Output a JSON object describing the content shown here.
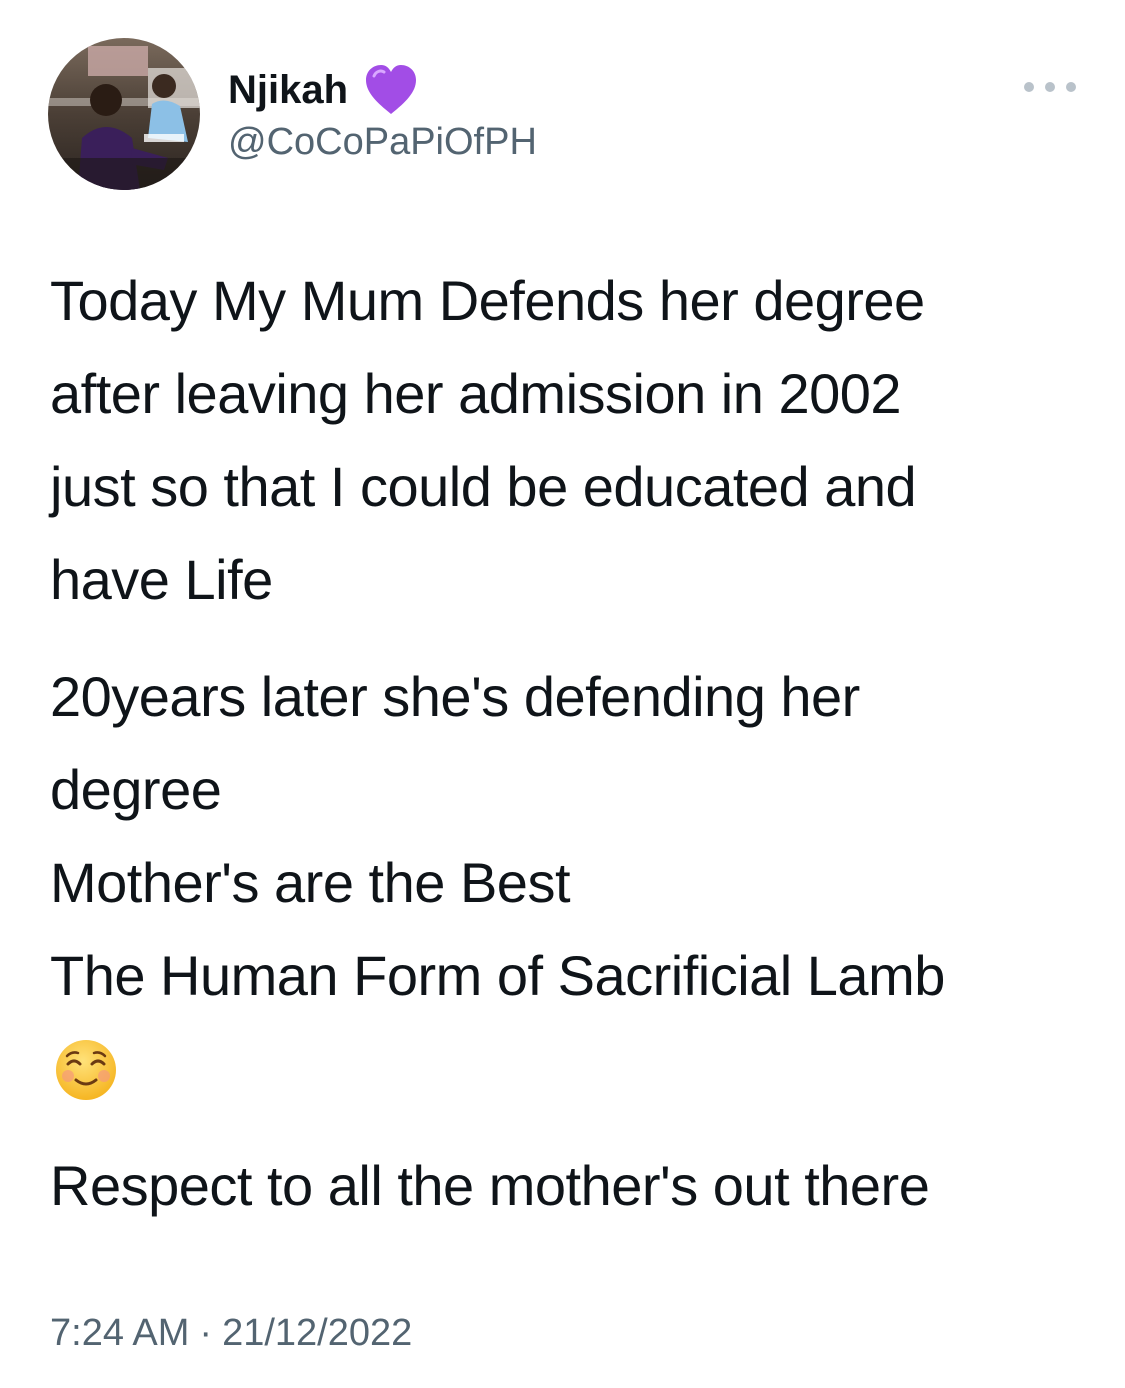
{
  "author": {
    "display_name": "Njikah",
    "handle": "@CoCoPaPiOfPH",
    "badge_icon": "purple-heart-icon",
    "badge_color": "#a24de6"
  },
  "tweet": {
    "paragraphs": [
      {
        "lines": [
          "Today My Mum Defends her degree",
          "after leaving her admission in 2002",
          "just so that I could be educated and",
          "have Life"
        ]
      },
      {
        "lines": [
          "20years later she's defending her",
          "degree",
          "Mother's are the Best",
          "The Human Form of Sacrificial Lamb"
        ],
        "emoji": "smiling-face-icon"
      },
      {
        "lines": [
          "Respect to all the mother's out there"
        ]
      }
    ]
  },
  "meta": {
    "time": "7:24 AM",
    "separator": "·",
    "date": "21/12/2022"
  },
  "menu": {
    "icon": "more-options-icon"
  },
  "colors": {
    "text": "#0f1419",
    "secondary_text": "#536471",
    "background": "#ffffff",
    "dots": "#b9c2ca"
  }
}
